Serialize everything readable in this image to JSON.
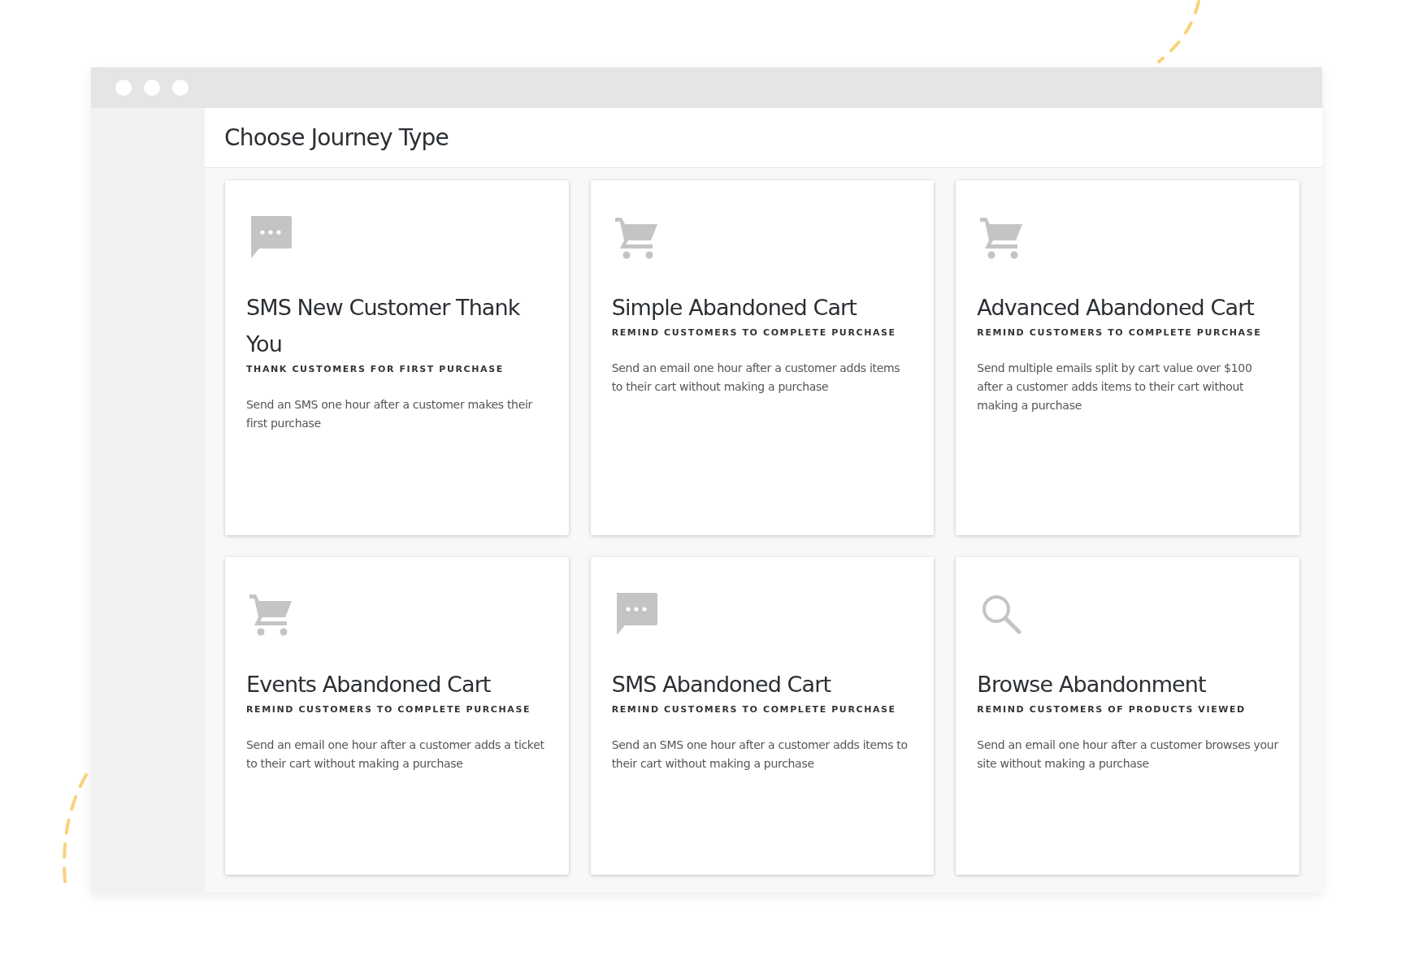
{
  "page": {
    "title": "Choose Journey Type"
  },
  "cards": [
    {
      "kind": "chat",
      "title": "SMS New Customer Thank You",
      "subtitle": "THANK CUSTOMERS FOR FIRST PURCHASE",
      "description": "Send an SMS one hour after a customer makes their first purchase"
    },
    {
      "kind": "cart",
      "title": "Simple Abandoned Cart",
      "subtitle": "REMIND CUSTOMERS TO COMPLETE PURCHASE",
      "description": "Send an email one hour after a customer adds items to their cart without making a purchase"
    },
    {
      "kind": "cart",
      "title": "Advanced Abandoned Cart",
      "subtitle": "REMIND CUSTOMERS TO COMPLETE PURCHASE",
      "description": "Send multiple emails split by cart value over $100 after a customer adds items to their cart without making a purchase"
    },
    {
      "kind": "cart",
      "title": "Events Abandoned Cart",
      "subtitle": "REMIND CUSTOMERS TO COMPLETE PURCHASE",
      "description": "Send an email one hour after a customer adds a ticket to their cart without making a purchase"
    },
    {
      "kind": "chat",
      "title": "SMS Abandoned Cart",
      "subtitle": "REMIND CUSTOMERS TO COMPLETE PURCHASE",
      "description": "Send an SMS one hour after a customer adds items to their cart without making a purchase"
    },
    {
      "kind": "search",
      "title": "Browse Abandonment",
      "subtitle": "REMIND CUSTOMERS OF PRODUCTS VIEWED",
      "description": "Send an email one hour after a customer browses your site without making a purchase"
    }
  ]
}
